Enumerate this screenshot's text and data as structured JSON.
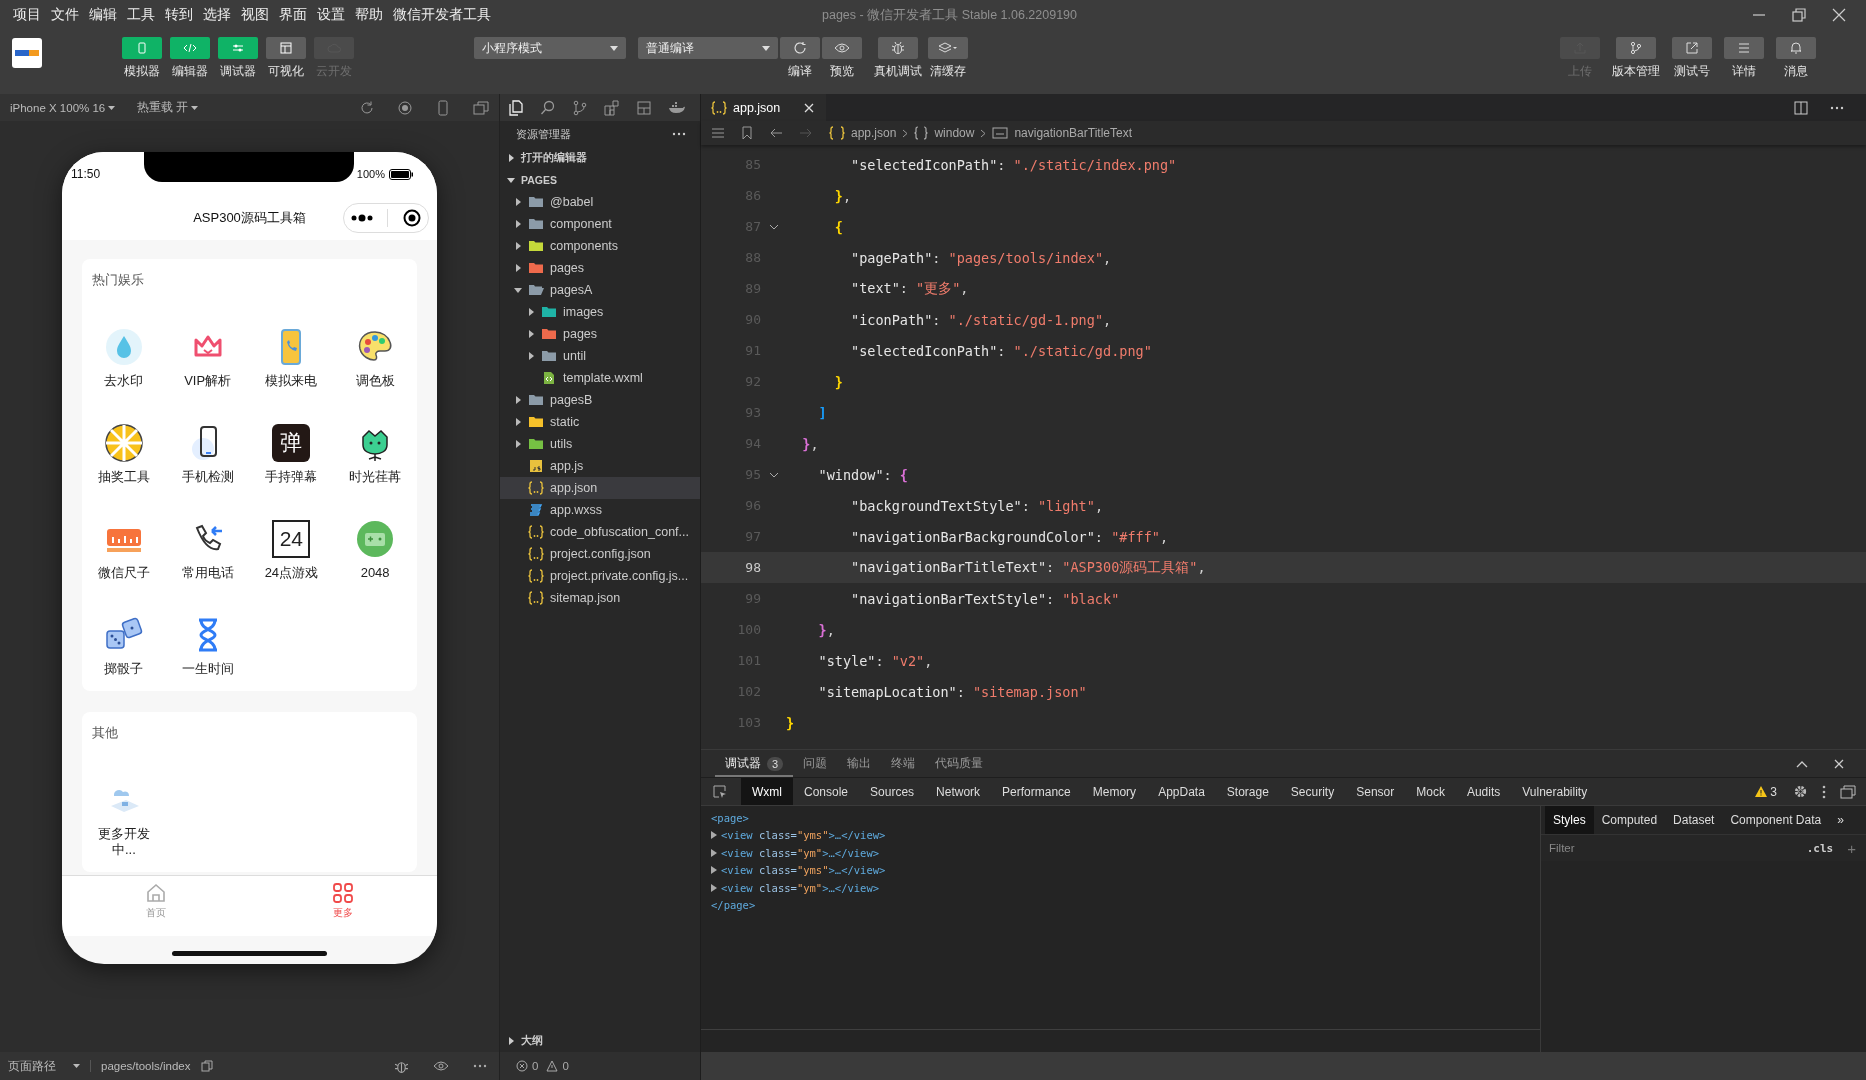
{
  "window": {
    "title": "pages - 微信开发者工具 Stable 1.06.2209190"
  },
  "menu": [
    "项目",
    "文件",
    "编辑",
    "工具",
    "转到",
    "选择",
    "视图",
    "界面",
    "设置",
    "帮助",
    "微信开发者工具"
  ],
  "toolbar": {
    "view_toggles": [
      {
        "label": "模拟器",
        "on": true,
        "disabled": false
      },
      {
        "label": "编辑器",
        "on": true,
        "disabled": false
      },
      {
        "label": "调试器",
        "on": true,
        "disabled": false
      },
      {
        "label": "可视化",
        "on": false,
        "disabled": false
      },
      {
        "label": "云开发",
        "on": false,
        "disabled": true
      }
    ],
    "mode_select": {
      "value": "小程序模式"
    },
    "compile_select": {
      "value": "普通编译"
    },
    "actions": [
      "编译",
      "预览",
      "真机调试",
      "清缓存"
    ],
    "right_actions": [
      {
        "label": "上传",
        "disabled": true
      },
      {
        "label": "版本管理",
        "disabled": false
      },
      {
        "label": "测试号",
        "disabled": false
      },
      {
        "label": "详情",
        "disabled": false
      },
      {
        "label": "消息",
        "disabled": false
      }
    ]
  },
  "simulator": {
    "device": "iPhone X 100% 16",
    "hot_reload": "热重载 开",
    "phone": {
      "time": "11:50",
      "battery": "100%",
      "nav_title": "ASP300源码工具箱",
      "sections": [
        {
          "title": "热门娱乐",
          "items": [
            {
              "label": "去水印"
            },
            {
              "label": "VIP解析"
            },
            {
              "label": "模拟来电"
            },
            {
              "label": "调色板"
            },
            {
              "label": "抽奖工具"
            },
            {
              "label": "手机检测"
            },
            {
              "label": "手持弹幕",
              "icon_text": "弹"
            },
            {
              "label": "时光荏苒"
            },
            {
              "label": "微信尺子"
            },
            {
              "label": "常用电话"
            },
            {
              "label": "24点游戏",
              "icon_text": "24"
            },
            {
              "label": "2048"
            },
            {
              "label": "掷骰子"
            },
            {
              "label": "一生时间"
            }
          ]
        },
        {
          "title": "其他",
          "items": [
            {
              "label": "更多开发中..."
            }
          ]
        }
      ],
      "tabbar": [
        {
          "label": "首页",
          "selected": false
        },
        {
          "label": "更多",
          "selected": true
        }
      ]
    },
    "page_path_label": "页面路径",
    "page_path": "pages/tools/index"
  },
  "tree": {
    "title": "资源管理器",
    "open_editors": {
      "label": "打开的编辑器",
      "expanded": false
    },
    "root": {
      "label": "PAGES",
      "expanded": true,
      "children": [
        {
          "name": "@babel",
          "kind": "folder",
          "color": "#8c9ba8",
          "expanded": false,
          "selected": false
        },
        {
          "name": "component",
          "kind": "folder",
          "color": "#8c9ba8",
          "expanded": false,
          "selected": false
        },
        {
          "name": "components",
          "kind": "folder",
          "color": "#c5d93a",
          "expanded": false,
          "selected": false
        },
        {
          "name": "pages",
          "kind": "folder",
          "color": "#ee6a4c",
          "expanded": false,
          "selected": false
        },
        {
          "name": "pagesA",
          "kind": "folder",
          "color": "#8c9ba8",
          "expanded": true,
          "selected": false,
          "children": [
            {
              "name": "images",
              "kind": "folder",
              "color": "#1fb3a6",
              "expanded": false,
              "selected": false
            },
            {
              "name": "pages",
              "kind": "folder",
              "color": "#ee6a4c",
              "expanded": false,
              "selected": false
            },
            {
              "name": "until",
              "kind": "folder",
              "color": "#8c9ba8",
              "expanded": false,
              "selected": false
            },
            {
              "name": "template.wxml",
              "kind": "wxml",
              "selected": false
            }
          ]
        },
        {
          "name": "pagesB",
          "kind": "folder",
          "color": "#8c9ba8",
          "expanded": false,
          "selected": false
        },
        {
          "name": "static",
          "kind": "folder",
          "color": "#f5c02a",
          "expanded": false,
          "selected": false
        },
        {
          "name": "utils",
          "kind": "folder",
          "color": "#76c043",
          "expanded": false,
          "selected": false
        },
        {
          "name": "app.js",
          "kind": "js",
          "selected": false
        },
        {
          "name": "app.json",
          "kind": "json",
          "selected": true
        },
        {
          "name": "app.wxss",
          "kind": "wxss",
          "selected": false
        },
        {
          "name": "code_obfuscation_conf...",
          "kind": "json",
          "selected": false
        },
        {
          "name": "project.config.json",
          "kind": "json",
          "selected": false
        },
        {
          "name": "project.private.config.js...",
          "kind": "json",
          "selected": false
        },
        {
          "name": "sitemap.json",
          "kind": "json",
          "selected": false
        }
      ]
    },
    "outline": {
      "label": "大纲",
      "expanded": false
    },
    "errors": "0",
    "warnings": "0"
  },
  "editor": {
    "tabs": [
      {
        "name": "app.json",
        "selected": true
      }
    ],
    "breadcrumb": [
      "app.json",
      "window",
      "navigationBarTitleText"
    ],
    "lines": [
      {
        "number": "85",
        "foldable": false,
        "current": false,
        "tokens": [
          {
            "text": "        \"selectedIconPath\"",
            "kind": "key"
          },
          {
            "text": ": ",
            "kind": "punct"
          },
          {
            "text": "\"./static/index.png\"",
            "kind": "string"
          }
        ]
      },
      {
        "number": "86",
        "foldable": false,
        "current": false,
        "tokens": [
          {
            "text": "      }",
            "kind": "brace",
            "color": "#ffd700"
          },
          {
            "text": ",",
            "kind": "punct"
          }
        ]
      },
      {
        "number": "87",
        "foldable": true,
        "current": false,
        "tokens": [
          {
            "text": "      {",
            "kind": "brace",
            "color": "#ffd700"
          }
        ]
      },
      {
        "number": "88",
        "foldable": false,
        "current": false,
        "tokens": [
          {
            "text": "        \"pagePath\"",
            "kind": "key"
          },
          {
            "text": ": ",
            "kind": "punct"
          },
          {
            "text": "\"pages/tools/index\"",
            "kind": "string"
          },
          {
            "text": ",",
            "kind": "punct"
          }
        ]
      },
      {
        "number": "89",
        "foldable": false,
        "current": false,
        "tokens": [
          {
            "text": "        \"text\"",
            "kind": "key"
          },
          {
            "text": ": ",
            "kind": "punct"
          },
          {
            "text": "\"更多\"",
            "kind": "string"
          },
          {
            "text": ",",
            "kind": "punct"
          }
        ]
      },
      {
        "number": "90",
        "foldable": false,
        "current": false,
        "tokens": [
          {
            "text": "        \"iconPath\"",
            "kind": "key"
          },
          {
            "text": ": ",
            "kind": "punct"
          },
          {
            "text": "\"./static/gd-1.png\"",
            "kind": "string"
          },
          {
            "text": ",",
            "kind": "punct"
          }
        ]
      },
      {
        "number": "91",
        "foldable": false,
        "current": false,
        "tokens": [
          {
            "text": "        \"selectedIconPath\"",
            "kind": "key"
          },
          {
            "text": ": ",
            "kind": "punct"
          },
          {
            "text": "\"./static/gd.png\"",
            "kind": "string"
          }
        ]
      },
      {
        "number": "92",
        "foldable": false,
        "current": false,
        "tokens": [
          {
            "text": "      }",
            "kind": "brace",
            "color": "#ffd700"
          }
        ]
      },
      {
        "number": "93",
        "foldable": false,
        "current": false,
        "tokens": [
          {
            "text": "    ]",
            "kind": "brace",
            "color": "#179fff"
          }
        ]
      },
      {
        "number": "94",
        "foldable": false,
        "current": false,
        "tokens": [
          {
            "text": "  }",
            "kind": "brace",
            "color": "#da70d6"
          },
          {
            "text": ",",
            "kind": "punct"
          }
        ]
      },
      {
        "number": "95",
        "foldable": true,
        "current": false,
        "tokens": [
          {
            "text": "    \"window\"",
            "kind": "key"
          },
          {
            "text": ": ",
            "kind": "punct"
          },
          {
            "text": "{",
            "kind": "brace",
            "color": "#da70d6"
          }
        ]
      },
      {
        "number": "96",
        "foldable": false,
        "current": false,
        "tokens": [
          {
            "text": "        \"backgroundTextStyle\"",
            "kind": "key"
          },
          {
            "text": ": ",
            "kind": "punct"
          },
          {
            "text": "\"light\"",
            "kind": "string"
          },
          {
            "text": ",",
            "kind": "punct"
          }
        ]
      },
      {
        "number": "97",
        "foldable": false,
        "current": false,
        "tokens": [
          {
            "text": "        \"navigationBarBackgroundColor\"",
            "kind": "key"
          },
          {
            "text": ": ",
            "kind": "punct"
          },
          {
            "text": "\"#fff\"",
            "kind": "string"
          },
          {
            "text": ",",
            "kind": "punct"
          }
        ]
      },
      {
        "number": "98",
        "foldable": false,
        "current": true,
        "tokens": [
          {
            "text": "        \"navigationBarTitleText\"",
            "kind": "key"
          },
          {
            "text": ": ",
            "kind": "punct"
          },
          {
            "text": "\"ASP300源码工具箱\"",
            "kind": "string"
          },
          {
            "text": ",",
            "kind": "punct"
          }
        ]
      },
      {
        "number": "99",
        "foldable": false,
        "current": false,
        "tokens": [
          {
            "text": "        \"navigationBarTextStyle\"",
            "kind": "key"
          },
          {
            "text": ": ",
            "kind": "punct"
          },
          {
            "text": "\"black\"",
            "kind": "string"
          }
        ]
      },
      {
        "number": "100",
        "foldable": false,
        "current": false,
        "tokens": [
          {
            "text": "    }",
            "kind": "brace",
            "color": "#da70d6"
          },
          {
            "text": ",",
            "kind": "punct"
          }
        ]
      },
      {
        "number": "101",
        "foldable": false,
        "current": false,
        "tokens": [
          {
            "text": "    \"style\"",
            "kind": "key"
          },
          {
            "text": ": ",
            "kind": "punct"
          },
          {
            "text": "\"v2\"",
            "kind": "string"
          },
          {
            "text": ",",
            "kind": "punct"
          }
        ]
      },
      {
        "number": "102",
        "foldable": false,
        "current": false,
        "tokens": [
          {
            "text": "    \"sitemapLocation\"",
            "kind": "key"
          },
          {
            "text": ": ",
            "kind": "punct"
          },
          {
            "text": "\"sitemap.json\"",
            "kind": "string"
          }
        ]
      },
      {
        "number": "103",
        "foldable": false,
        "current": false,
        "tokens": [
          {
            "text": "}",
            "kind": "brace",
            "color": "#ffd700"
          }
        ]
      }
    ]
  },
  "devtools": {
    "tabs": [
      {
        "label": "调试器",
        "selected": true,
        "badge": "3"
      },
      {
        "label": "问题",
        "selected": false
      },
      {
        "label": "输出",
        "selected": false
      },
      {
        "label": "终端",
        "selected": false
      },
      {
        "label": "代码质量",
        "selected": false
      }
    ],
    "panels": [
      {
        "label": "Wxml",
        "selected": true
      },
      {
        "label": "Console",
        "selected": false
      },
      {
        "label": "Sources",
        "selected": false
      },
      {
        "label": "Network",
        "selected": false
      },
      {
        "label": "Performance",
        "selected": false
      },
      {
        "label": "Memory",
        "selected": false
      },
      {
        "label": "AppData",
        "selected": false
      },
      {
        "label": "Storage",
        "selected": false
      },
      {
        "label": "Security",
        "selected": false
      },
      {
        "label": "Sensor",
        "selected": false
      },
      {
        "label": "Mock",
        "selected": false
      },
      {
        "label": "Audits",
        "selected": false
      },
      {
        "label": "Vulnerability",
        "selected": false
      }
    ],
    "warnings": "3",
    "wxml": [
      {
        "kind": "plain",
        "tokens": [
          {
            "text": "<page>",
            "kind": "tag"
          }
        ]
      },
      {
        "kind": "collapsed",
        "tokens": [
          {
            "text": "<view",
            "kind": "tag"
          },
          {
            "text": " class=",
            "kind": "attr"
          },
          {
            "text": "\"yms\"",
            "kind": "value"
          },
          {
            "text": ">…</view>",
            "kind": "tag"
          }
        ]
      },
      {
        "kind": "collapsed",
        "tokens": [
          {
            "text": "<view",
            "kind": "tag"
          },
          {
            "text": " class=",
            "kind": "attr"
          },
          {
            "text": "\"ym\"",
            "kind": "value"
          },
          {
            "text": ">…</view>",
            "kind": "tag"
          }
        ]
      },
      {
        "kind": "collapsed",
        "tokens": [
          {
            "text": "<view",
            "kind": "tag"
          },
          {
            "text": " class=",
            "kind": "attr"
          },
          {
            "text": "\"yms\"",
            "kind": "value"
          },
          {
            "text": ">…</view>",
            "kind": "tag"
          }
        ]
      },
      {
        "kind": "collapsed",
        "tokens": [
          {
            "text": "<view",
            "kind": "tag"
          },
          {
            "text": " class=",
            "kind": "attr"
          },
          {
            "text": "\"ym\"",
            "kind": "value"
          },
          {
            "text": ">…</view>",
            "kind": "tag"
          }
        ]
      },
      {
        "kind": "plain",
        "tokens": [
          {
            "text": "</page>",
            "kind": "tag"
          }
        ]
      }
    ],
    "styles": {
      "tabs": [
        {
          "label": "Styles",
          "selected": true
        },
        {
          "label": "Computed",
          "selected": false
        },
        {
          "label": "Dataset",
          "selected": false
        },
        {
          "label": "Component Data",
          "selected": false
        }
      ],
      "more": "»",
      "filter_placeholder": "Filter",
      "cls": ".cls",
      "add": "+"
    }
  }
}
